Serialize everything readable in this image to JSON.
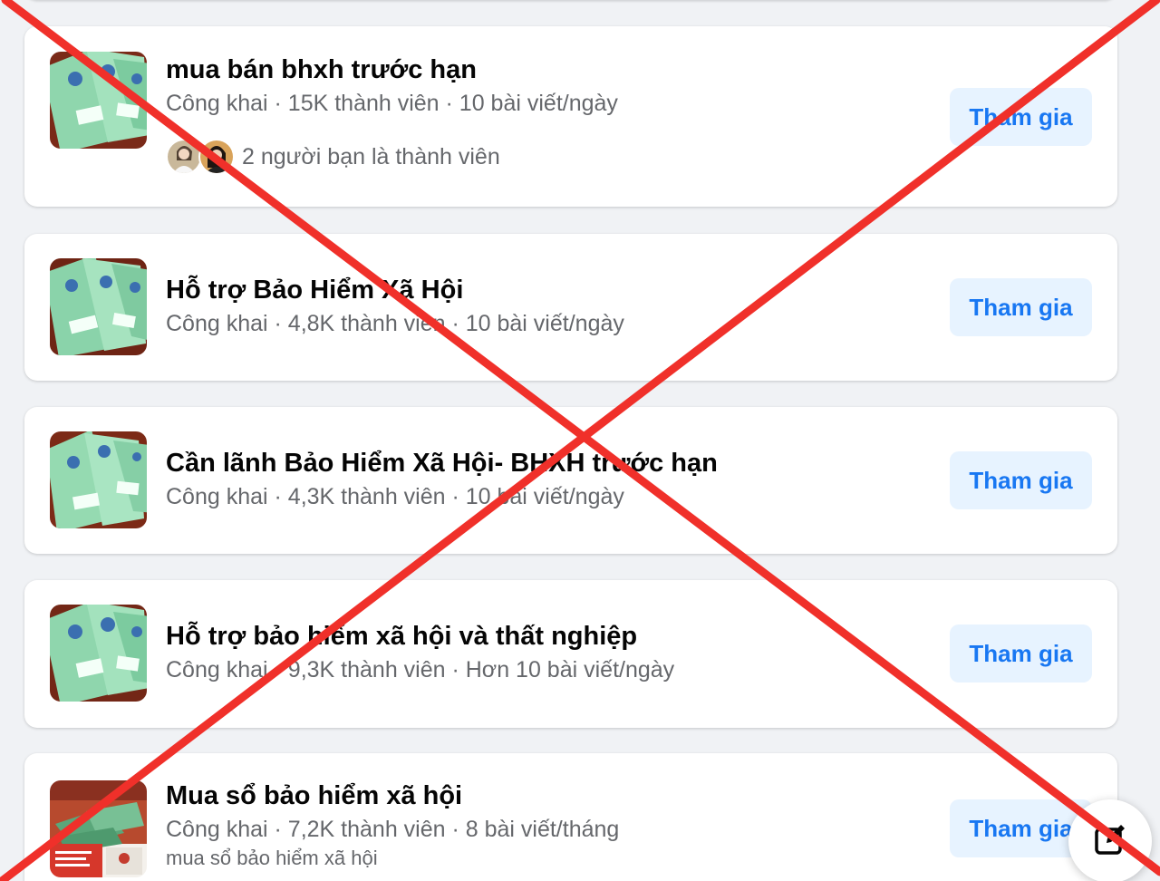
{
  "groups": [
    {
      "name": "mua bán bhxh trước hạn",
      "meta": "Công khai · 15K thành viên · 10 bài viết/ngày",
      "friends_text": "2 người bạn là thành viên",
      "join_label": "Tham gia"
    },
    {
      "name": "Hỗ trợ Bảo Hiểm Xã Hội",
      "meta": "Công khai · 4,8K thành viên · 10 bài viết/ngày",
      "join_label": "Tham gia"
    },
    {
      "name": "Cần lãnh Bảo Hiểm Xã Hội- BHXH trước hạn",
      "meta": "Công khai · 4,3K thành viên · 10 bài viết/ngày",
      "join_label": "Tham gia"
    },
    {
      "name": "Hỗ trợ bảo hiểm xã hội và thất nghiệp",
      "meta": "Công khai · 9,3K thành viên · Hơn 10 bài viết/ngày",
      "join_label": "Tham gia"
    },
    {
      "name": "Mua sổ bảo hiểm xã hội",
      "meta": "Công khai · 7,2K thành viên · 8 bài viết/tháng",
      "description": "mua sổ bảo hiểm xã hội",
      "join_label": "Tham gia"
    }
  ],
  "fab_icon": "compose-icon",
  "overlay_icon": "red-cross-mark",
  "colors": {
    "accent": "#1877f2",
    "join_bg": "#e7f3ff",
    "overlay_red": "#f0302a",
    "card_bg": "#ffffff",
    "page_bg": "#f0f2f5"
  }
}
